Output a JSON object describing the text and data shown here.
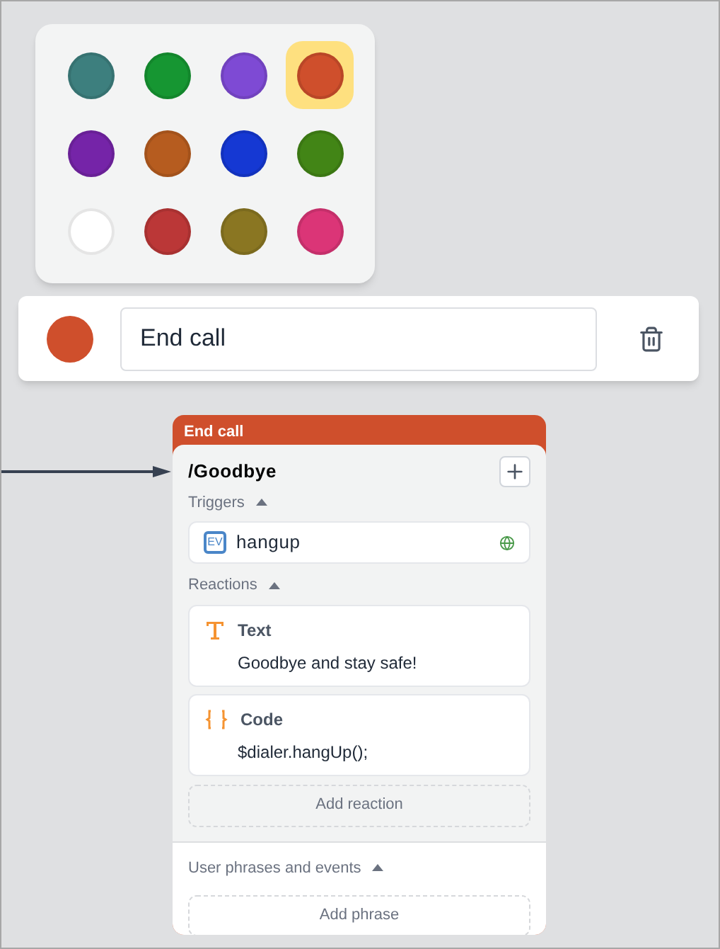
{
  "palette": [
    {
      "color": "#3d7f7e",
      "selected": false
    },
    {
      "color": "#169632",
      "selected": false
    },
    {
      "color": "#7e4ad4",
      "selected": false
    },
    {
      "color": "#cf4f2c",
      "selected": true
    },
    {
      "color": "#7524a8",
      "selected": false
    },
    {
      "color": "#b65c1f",
      "selected": false
    },
    {
      "color": "#1538d3",
      "selected": false
    },
    {
      "color": "#428516",
      "selected": false
    },
    {
      "color": "#ffffff",
      "selected": false
    },
    {
      "color": "#bb3737",
      "selected": false
    },
    {
      "color": "#8a7622",
      "selected": false
    },
    {
      "color": "#db3577",
      "selected": false
    }
  ],
  "name_bar": {
    "color": "#cf4f2c",
    "value": "End call"
  },
  "node": {
    "header": "End call",
    "color": "#cf4f2c",
    "state": "/Goodbye",
    "triggers_label": "Triggers",
    "triggers": [
      {
        "badge": "EV",
        "name": "hangup"
      }
    ],
    "reactions_label": "Reactions",
    "reactions": [
      {
        "kind": "text",
        "title": "Text",
        "body": "Goodbye and stay safe!"
      },
      {
        "kind": "code",
        "title": "Code",
        "body": "$dialer.hangUp();"
      }
    ],
    "add_reaction": "Add reaction",
    "phrases_label": "User phrases and events",
    "add_phrase": "Add phrase"
  }
}
